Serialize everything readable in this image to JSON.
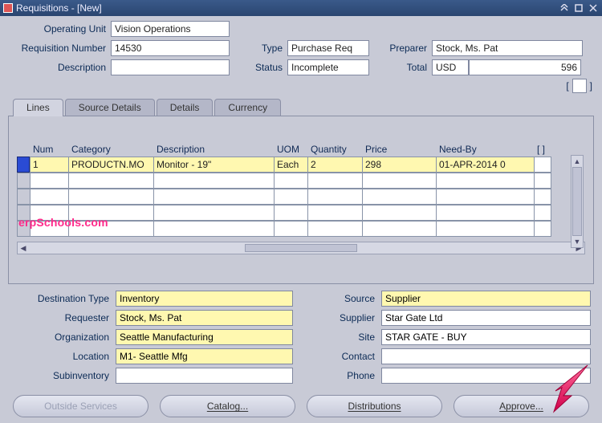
{
  "window": {
    "title": "Requisitions - [New]"
  },
  "header": {
    "operating_unit_label": "Operating Unit",
    "operating_unit": "Vision Operations",
    "req_number_label": "Requisition Number",
    "req_number": "14530",
    "type_label": "Type",
    "type": "Purchase Req",
    "preparer_label": "Preparer",
    "preparer": "Stock, Ms. Pat",
    "description_label": "Description",
    "description": "",
    "status_label": "Status",
    "status": "Incomplete",
    "total_label": "Total",
    "total_currency": "USD",
    "total_amount": "596"
  },
  "tabs": {
    "lines": "Lines",
    "source_details": "Source Details",
    "details": "Details",
    "currency": "Currency",
    "active_index": 0
  },
  "grid": {
    "columns": {
      "num": "Num",
      "category": "Category",
      "description": "Description",
      "uom": "UOM",
      "quantity": "Quantity",
      "price": "Price",
      "need_by": "Need-By",
      "bracket": "[  ]"
    },
    "rows": [
      {
        "num": "1",
        "category": "PRODUCTN.MO",
        "description": "Monitor - 19\"",
        "uom": "Each",
        "quantity": "2",
        "price": "298",
        "need_by": "01-APR-2014 0"
      }
    ]
  },
  "watermark": "erpSchools.com",
  "details_left": {
    "destination_type_label": "Destination Type",
    "destination_type": "Inventory",
    "requester_label": "Requester",
    "requester": "Stock, Ms. Pat",
    "organization_label": "Organization",
    "organization": "Seattle Manufacturing",
    "location_label": "Location",
    "location": "M1- Seattle Mfg",
    "subinventory_label": "Subinventory",
    "subinventory": ""
  },
  "details_right": {
    "source_label": "Source",
    "source": "Supplier",
    "supplier_label": "Supplier",
    "supplier": "Star Gate Ltd",
    "site_label": "Site",
    "site": "STAR GATE - BUY",
    "contact_label": "Contact",
    "contact": "",
    "phone_label": "Phone",
    "phone": ""
  },
  "buttons": {
    "outside_services": "Outside Services",
    "catalog": "Catalog...",
    "distributions": "Distributions",
    "approve": "Approve..."
  }
}
